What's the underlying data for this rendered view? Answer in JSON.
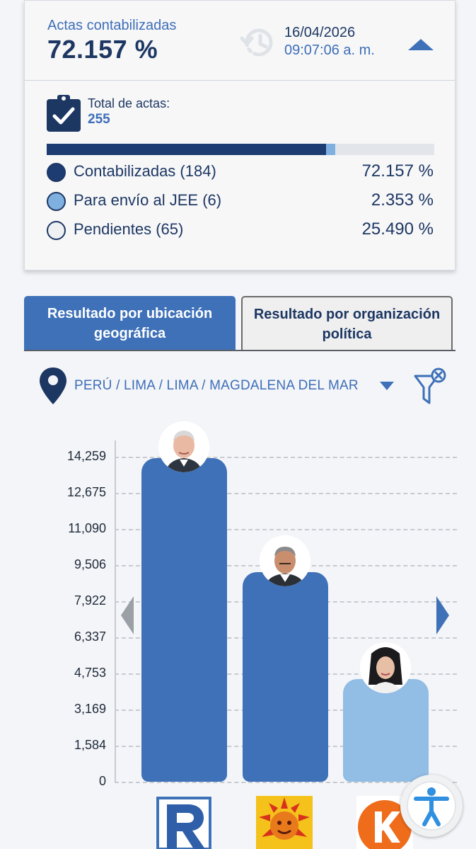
{
  "summary": {
    "counted_label": "Actas contabilizadas",
    "counted_value": "72.157 %",
    "date": "16/04/2026",
    "time": "09:07:06 a. m.",
    "total_label": "Total de actas:",
    "total_value": "255"
  },
  "progress": [
    {
      "name": "Contabilizadas",
      "fraction": 0.72157,
      "color": "#1d3c72"
    },
    {
      "name": "Para envío al JEE",
      "fraction": 0.02353,
      "color": "#7fb0e0"
    },
    {
      "name": "Pendientes",
      "fraction": 0.2549,
      "color": "#e2e5ea"
    }
  ],
  "legend": [
    {
      "label": "Contabilizadas (184)",
      "pct": "72.157 %",
      "color": "#1d3c72"
    },
    {
      "label": "Para envío al JEE (6)",
      "pct": "2.353 %",
      "color": "#7fb0e0"
    },
    {
      "label": "Pendientes (65)",
      "pct": "25.490 %",
      "color": "#eef0f3"
    }
  ],
  "tabs": {
    "geo": "Resultado por ubicación geográfica",
    "org": "Resultado por organización política"
  },
  "location": {
    "path": "PERÚ / LIMA / LIMA / MAGDALENA DEL MAR"
  },
  "icons": {
    "clock": "clock-history-icon",
    "collapse": "caret-up-icon",
    "clipboard": "clipboard-check-icon",
    "pin": "map-pin-icon",
    "filter": "filter-clear-icon",
    "accessibility": "accessibility-icon"
  },
  "colors": {
    "primary": "#3e71b8",
    "navy": "#1d3763",
    "bar_light": "#92bde5"
  },
  "chart_data": {
    "type": "bar",
    "yticks": [
      "0",
      "1,584",
      "3,169",
      "4,753",
      "6,337",
      "7,922",
      "9,506",
      "11,090",
      "12,675",
      "14,259"
    ],
    "ylim": [
      0,
      14259
    ],
    "values": [
      14200,
      9200,
      4500
    ],
    "colors": [
      "#3e71b8",
      "#3e71b8",
      "#92bde5"
    ],
    "grid": true
  }
}
